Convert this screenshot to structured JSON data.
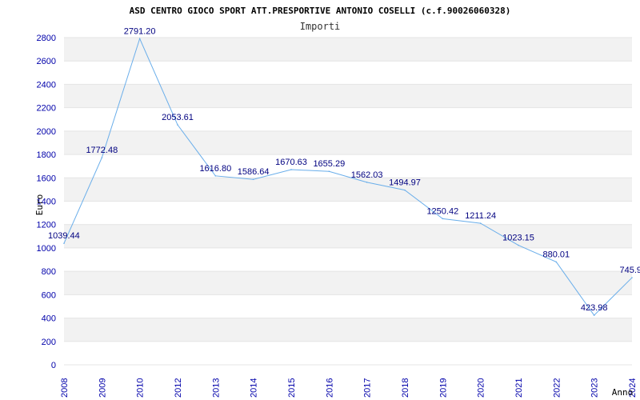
{
  "chart_data": {
    "type": "line",
    "title": "ASD CENTRO GIOCO SPORT ATT.PRESPORTIVE ANTONIO COSELLI (c.f.90026060328)",
    "subtitle": "Importi",
    "xlabel": "Anno",
    "ylabel": "Euro",
    "ylim": [
      0,
      2800
    ],
    "yticks": [
      0,
      200,
      400,
      600,
      800,
      1000,
      1200,
      1400,
      1600,
      1800,
      2000,
      2200,
      2400,
      2600,
      2800
    ],
    "grid": "horizontal bands",
    "x": [
      "2008",
      "2009",
      "2010",
      "2012",
      "2013",
      "2014",
      "2015",
      "2016",
      "2017",
      "2018",
      "2019",
      "2020",
      "2021",
      "2022",
      "2023",
      "2024"
    ],
    "values": [
      1039.44,
      1772.48,
      2791.2,
      2053.61,
      1616.8,
      1586.64,
      1670.63,
      1655.29,
      1562.03,
      1494.97,
      1250.42,
      1211.24,
      1023.15,
      880.01,
      423.98,
      745.9
    ],
    "labels": [
      "1039.44",
      "1772.48",
      "2791.20",
      "2053.61",
      "1616.80",
      "1586.64",
      "1670.63",
      "1655.29",
      "1562.03",
      "1494.97",
      "1250.42",
      "1211.24",
      "1023.15",
      "880.01",
      "423.98",
      "745.9"
    ],
    "colors": {
      "line": "#6aaeea",
      "band": "#f2f2f2",
      "tick": "#0000aa",
      "label": "#000080"
    }
  }
}
